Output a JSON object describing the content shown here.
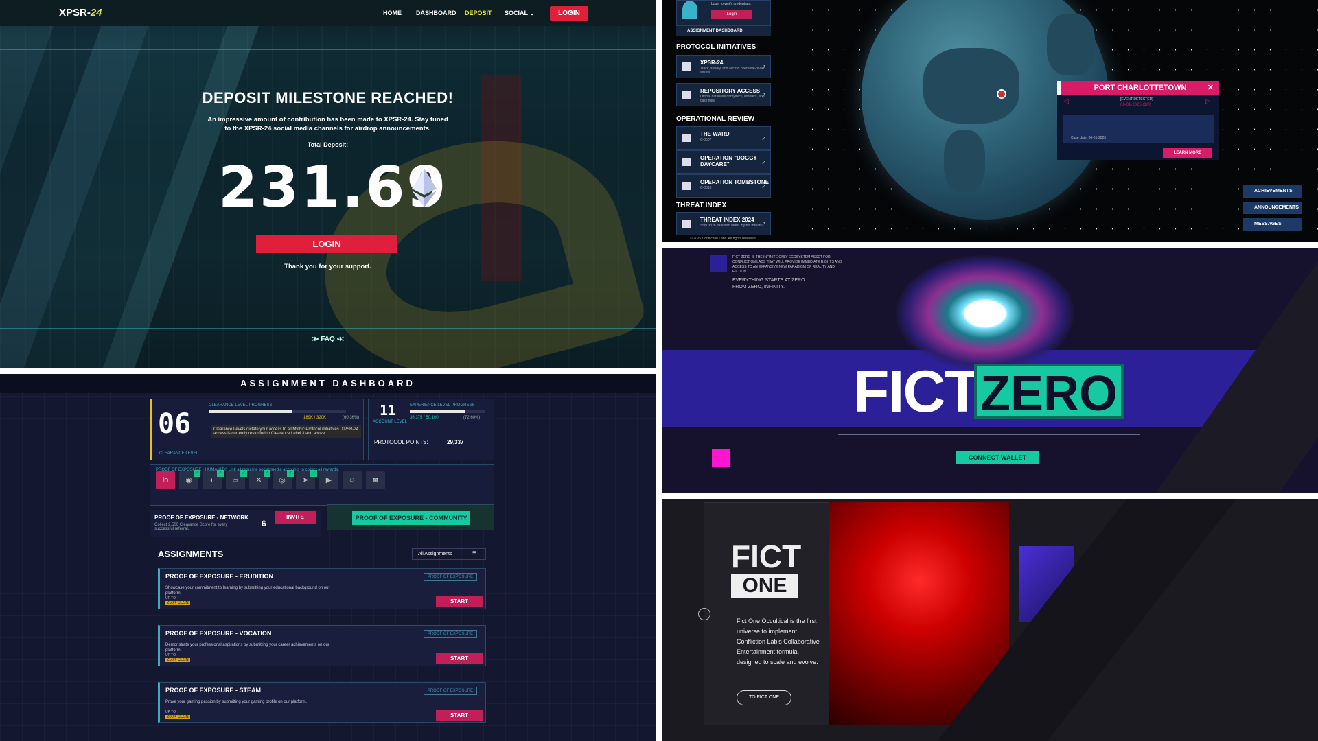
{
  "deposit": {
    "logo_a": "XPSR-",
    "logo_b": "24",
    "nav": [
      "HOME",
      "DASHBOARD",
      "DEPOSIT",
      "SOCIAL ⌄"
    ],
    "nav_login": "LOGIN",
    "heading": "DEPOSIT MILESTONE REACHED!",
    "subtitle": "An impressive amount of contribution has been made to XPSR-24. Stay tuned to the XPSR-24 social media channels for airdrop announcements.",
    "total_label": "Total Deposit:",
    "total_value": "231.69",
    "login_button": "LOGIN",
    "thanks": "Thank you for your support.",
    "faq": "≫ FAQ ≪"
  },
  "dashboard": {
    "title": "ASSIGNMENT DASHBOARD",
    "clearance_level": "06",
    "clearance_label": "CLEARANCE LEVEL",
    "clearance_progress_label": "CLEARANCE LEVEL PROGRESS",
    "clearance_progress_value": "189K / 320K",
    "clearance_progress_pct": "(60.36%)",
    "clearance_progress_fraction": 0.6036,
    "clearance_note": "Clearance Levels dictate your access to all Mythic Protocol initiatives. XPSR-24 access is currently restricted to Clearance Level 3 and above.",
    "account_level": "11",
    "account_label": "ACCOUNT LEVEL",
    "xp_progress_label": "EXPERIENCE LEVEL PROGRESS",
    "xp_progress_value": "36,375 / 50,100",
    "xp_progress_pct": "(72.60%)",
    "xp_progress_fraction": 0.726,
    "protocol_points_label": "PROTOCOL POINTS:",
    "protocol_points_value": "29,337",
    "poe_humanity": "PROOF OF EXPOSURE - HUMANITY. Link all requisite social media accounts to collect all rewards.",
    "poe_network": "PROOF OF EXPOSURE - NETWORK",
    "poe_network_note": "Collect 2,500 Clearance Score for every successful referral.",
    "referrals": "6",
    "invite": "INVITE",
    "poe_community": "PROOF OF EXPOSURE - COMMUNITY",
    "assignments_heading": "ASSIGNMENTS",
    "filter": "All Assignments",
    "cards": [
      {
        "title": "PROOF OF EXPOSURE - ERUDITION",
        "desc": "Showcase your commitment to learning by submitting your educational background on our platform.",
        "tag": "PROOF OF EXPOSURE",
        "up_to": "UP TO",
        "reward": "250K CLSN",
        "start": "START"
      },
      {
        "title": "PROOF OF EXPOSURE - VOCATION",
        "desc": "Demonstrate your professional aspirations by submitting your career achievements on our platform.",
        "tag": "PROOF OF EXPOSURE",
        "up_to": "UP TO",
        "reward": "250K CLSN",
        "start": "START"
      },
      {
        "title": "PROOF OF EXPOSURE - STEAM",
        "desc": "Prove your gaming passion by submitting your gaming profile on our platform.",
        "tag": "PROOF OF EXPOSURE",
        "up_to": "UP TO",
        "reward": "200K CLSN",
        "start": "START"
      }
    ]
  },
  "globe": {
    "login_prompt": "Login to verify credentials.",
    "login": "Login",
    "assignment_dashboard": "ASSIGNMENT DASHBOARD",
    "sections": {
      "protocol": "PROTOCOL INITIATIVES",
      "operational": "OPERATIONAL REVIEW",
      "threat": "THREAT INDEX"
    },
    "items": {
      "xpsr": {
        "title": "XPSR-24",
        "desc": "Track, survey, and access operative-based assets."
      },
      "repo": {
        "title": "REPOSITORY ACCESS",
        "desc": "Official database of mythics, dossiers, and case files."
      },
      "ward": {
        "title": "THE WARD",
        "desc": "C-0007"
      },
      "doggy": {
        "title": "OPERATION \"DOGGY DAYCARE\"",
        "desc": "C-0013"
      },
      "tomb": {
        "title": "OPERATION TOMBSTONE",
        "desc": "C-0018"
      },
      "threat": {
        "title": "THREAT INDEX 2024",
        "desc": "Stay up to date with latest mythic threats."
      }
    },
    "copyright": "© 2025 Confliction Labs. All rights reserved.",
    "popup_title": "PORT CHARLOTTETOWN",
    "popup_event": "[EVENT DETECTED]",
    "popup_date": "06-01-2025 (1/0)",
    "popup_case": "Case date: 06-01-2025",
    "learn_more": "LEARN MORE",
    "right_buttons": [
      "ACHIEVEMENTS",
      "ANNOUNCEMENTS",
      "MESSAGES"
    ]
  },
  "fictzero": {
    "intro": "FICT ZERO IS THE INFINITE ONLY ECOSYSTEM ASSET FOR CONFLICTION LABS THAT WILL PROVIDE IMMEDIATE RIGHTS AND ACCESS TO AN EXPANSIVE NEW PARADIGM OF REALITY AND FICTION.",
    "tagline1": "EVERYTHING STARTS AT ZERO.",
    "tagline2": "FROM ZERO, INFINITY.",
    "fict": "FICT",
    "zero": "ZERO",
    "connect": "CONNECT WALLET"
  },
  "fictone": {
    "logo_fict": "FICT",
    "logo_one": "ONE",
    "desc": "Fict One Occultical is the first universe to implement Confliction Lab's Collaborative Entertainment formula, designed to scale and evolve.",
    "button": "TO FICT ONE"
  }
}
